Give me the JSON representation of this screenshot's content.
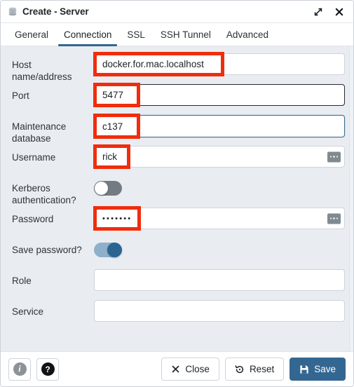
{
  "window": {
    "title": "Create - Server",
    "icon": "server-stack-icon",
    "controls": {
      "maximize": "maximize-icon",
      "close": "close-icon"
    }
  },
  "tabs": {
    "items": [
      {
        "label": "General",
        "active": false
      },
      {
        "label": "Connection",
        "active": true
      },
      {
        "label": "SSL",
        "active": false
      },
      {
        "label": "SSH Tunnel",
        "active": false
      },
      {
        "label": "Advanced",
        "active": false
      }
    ],
    "active_underline_color": "#336791"
  },
  "form": {
    "fields": [
      {
        "label": "Host name/address",
        "type": "text",
        "value": "docker.for.mac.localhost",
        "annotated": true,
        "border": "normal",
        "ellipsis": false
      },
      {
        "label": "Port",
        "type": "text",
        "value": "5477",
        "annotated": true,
        "border": "dark",
        "ellipsis": false
      },
      {
        "label": "Maintenance database",
        "type": "text",
        "value": "c137",
        "annotated": true,
        "border": "focus",
        "ellipsis": false
      },
      {
        "label": "Username",
        "type": "text",
        "value": "rick",
        "annotated": true,
        "border": "normal",
        "ellipsis": true
      },
      {
        "label": "Kerberos authentication?",
        "type": "toggle",
        "state": "off",
        "annotated": false
      },
      {
        "label": "Password",
        "type": "password",
        "value": "•••••••",
        "annotated": true,
        "border": "normal",
        "ellipsis": true
      },
      {
        "label": "Save password?",
        "type": "toggle",
        "state": "on",
        "annotated": false
      },
      {
        "label": "Role",
        "type": "text",
        "value": "",
        "annotated": false,
        "border": "normal",
        "ellipsis": false
      },
      {
        "label": "Service",
        "type": "text",
        "value": "",
        "annotated": false,
        "border": "normal",
        "ellipsis": false
      }
    ]
  },
  "footer": {
    "info_label": "i",
    "help_label": "?",
    "close_label": "Close",
    "reset_label": "Reset",
    "save_label": "Save"
  },
  "colors": {
    "accent": "#336791",
    "annotation": "#f02d0c",
    "background": "#e9edf2",
    "toggle_on_track": "#8fb0ca",
    "toggle_on_knob": "#2b6490",
    "toggle_off_track": "#737b82"
  }
}
